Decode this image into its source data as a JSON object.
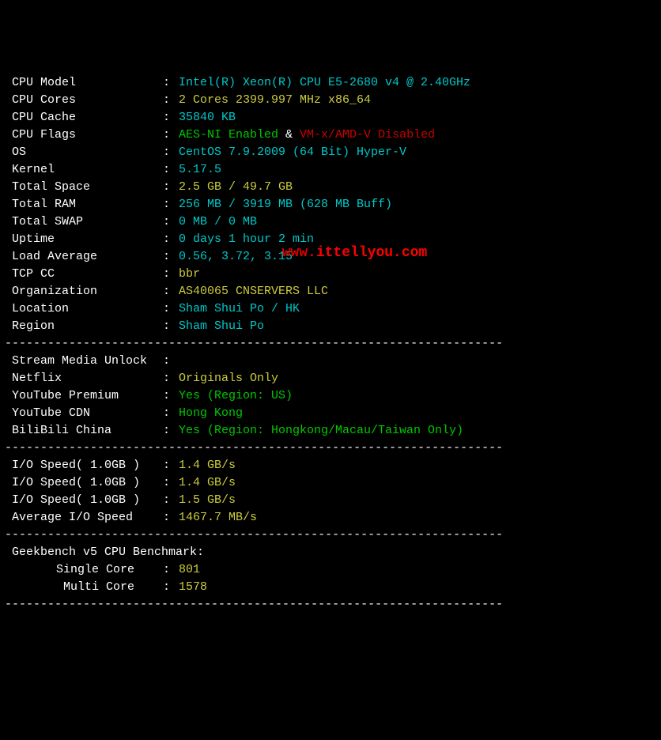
{
  "rows": [
    {
      "type": "kv",
      "label": " CPU Model",
      "value": "Intel(R) Xeon(R) CPU E5-2680 v4 @ 2.40GHz",
      "cls": "v-cyan"
    },
    {
      "type": "kv",
      "label": " CPU Cores",
      "value": "2 Cores 2399.997 MHz x86_64",
      "cls": "v-yellow"
    },
    {
      "type": "kv",
      "label": " CPU Cache",
      "value": "35840 KB",
      "cls": "v-cyan"
    },
    {
      "type": "compound",
      "label": " CPU Flags",
      "parts": [
        {
          "text": "AES-NI Enabled",
          "cls": "v-green"
        },
        {
          "text": " & ",
          "cls": ""
        },
        {
          "text": "VM-x/AMD-V Disabled",
          "cls": "v-red"
        }
      ]
    },
    {
      "type": "kv",
      "label": " OS",
      "value": "CentOS 7.9.2009 (64 Bit) Hyper-V",
      "cls": "v-cyan"
    },
    {
      "type": "kv",
      "label": " Kernel",
      "value": "5.17.5",
      "cls": "v-cyan"
    },
    {
      "type": "kv",
      "label": " Total Space",
      "value": "2.5 GB / 49.7 GB",
      "cls": "v-yellow"
    },
    {
      "type": "kv",
      "label": " Total RAM",
      "value": "256 MB / 3919 MB (628 MB Buff)",
      "cls": "v-cyan"
    },
    {
      "type": "kv",
      "label": " Total SWAP",
      "value": "0 MB / 0 MB",
      "cls": "v-cyan"
    },
    {
      "type": "kv",
      "label": " Uptime",
      "value": "0 days 1 hour 2 min",
      "cls": "v-cyan"
    },
    {
      "type": "kv",
      "label": " Load Average",
      "value": "0.56, 3.72, 3.15",
      "cls": "v-cyan"
    },
    {
      "type": "kv",
      "label": " TCP CC",
      "value": "bbr",
      "cls": "v-yellow"
    },
    {
      "type": "kv",
      "label": " Organization",
      "value": "AS40065 CNSERVERS LLC",
      "cls": "v-yellow"
    },
    {
      "type": "kv",
      "label": " Location",
      "value": "Sham Shui Po / HK",
      "cls": "v-cyan"
    },
    {
      "type": "kv",
      "label": " Region",
      "value": "Sham Shui Po",
      "cls": "v-cyan"
    },
    {
      "type": "dash"
    },
    {
      "type": "kvonly",
      "label": " Stream Media Unlock"
    },
    {
      "type": "kv",
      "label": " Netflix",
      "value": "Originals Only",
      "cls": "v-yellow"
    },
    {
      "type": "kv",
      "label": " YouTube Premium",
      "value": "Yes (Region: US)",
      "cls": "v-green"
    },
    {
      "type": "kv",
      "label": " YouTube CDN",
      "value": "Hong Kong",
      "cls": "v-green"
    },
    {
      "type": "kv",
      "label": " BiliBili China",
      "value": "Yes (Region: Hongkong/Macau/Taiwan Only)",
      "cls": "v-green"
    },
    {
      "type": "dash"
    },
    {
      "type": "kv",
      "label": " I/O Speed( 1.0GB )",
      "value": "1.4 GB/s",
      "cls": "v-yellow"
    },
    {
      "type": "kv",
      "label": " I/O Speed( 1.0GB )",
      "value": "1.4 GB/s",
      "cls": "v-yellow"
    },
    {
      "type": "kv",
      "label": " I/O Speed( 1.0GB )",
      "value": "1.5 GB/s",
      "cls": "v-yellow"
    },
    {
      "type": "kv",
      "label": " Average I/O Speed",
      "value": "1467.7 MB/s",
      "cls": "v-yellow"
    },
    {
      "type": "dash"
    },
    {
      "type": "plain",
      "text": " Geekbench v5 CPU Benchmark:"
    },
    {
      "type": "bench",
      "label": "Single Core    ",
      "value": "801",
      "cls": "v-yellow"
    },
    {
      "type": "bench",
      "label": "Multi Core    ",
      "value": "1578",
      "cls": "v-yellow"
    },
    {
      "type": "dash"
    }
  ],
  "separator": ":",
  "dashline": "----------------------------------------------------------------------",
  "watermark": {
    "part1": "www.",
    "part2": "ittellyou.com"
  }
}
